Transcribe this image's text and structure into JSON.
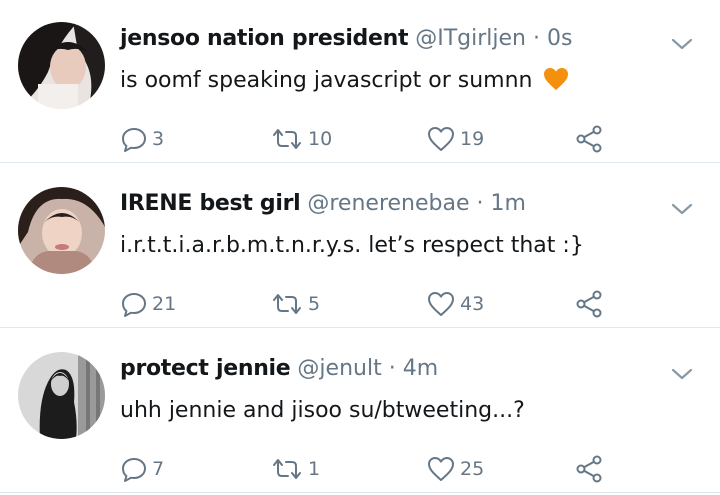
{
  "tweets": [
    {
      "name": "jensoo nation president",
      "handle": "@ITgirljen",
      "separator": "·",
      "time": "0s",
      "text": "is oomf speaking javascript or sumnn",
      "emoji": "orange-heart",
      "replies": "3",
      "retweets": "10",
      "likes": "19"
    },
    {
      "name": "IRENE best girl",
      "handle": "@renerenebae",
      "separator": "·",
      "time": "1m",
      "text": "i.r.t.t.i.a.r.b.m.t.n.r.y.s. let’s respect that :}",
      "replies": "21",
      "retweets": "5",
      "likes": "43"
    },
    {
      "name": "protect jennie",
      "handle": "@jenult",
      "separator": "·",
      "time": "4m",
      "text": "uhh jennie and jisoo su/btweeting...?",
      "replies": "7",
      "retweets": "1",
      "likes": "25"
    }
  ],
  "colors": {
    "text": "#14171a",
    "secondary": "#657786",
    "divider": "#e1e8ed",
    "heart_emoji": "#f4900c"
  },
  "icons": [
    "avatar",
    "chevron-down-icon",
    "reply-icon",
    "retweet-icon",
    "like-icon",
    "share-icon",
    "orange-heart-emoji"
  ]
}
